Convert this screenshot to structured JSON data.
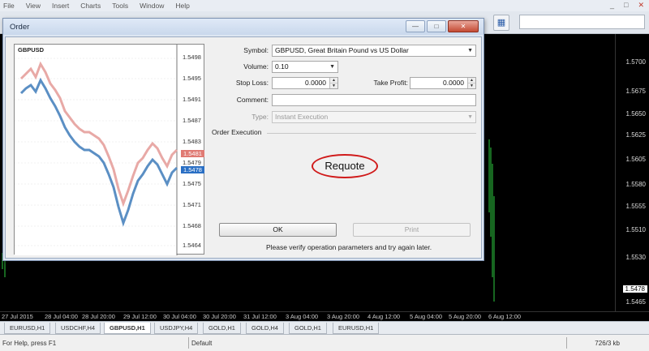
{
  "menu": [
    "File",
    "View",
    "Insert",
    "Charts",
    "Tools",
    "Window",
    "Help"
  ],
  "window_controls": [
    "_",
    "□",
    "✕"
  ],
  "chart": {
    "y_labels": [
      "1.5700",
      "1.5675",
      "1.5650",
      "1.5625",
      "1.5605",
      "1.5580",
      "1.5555",
      "1.5530",
      "1.5510",
      "1.5465"
    ],
    "price_tag": "1.5478",
    "x_labels": [
      "27 Jul 2015",
      "28 Jul 04:00",
      "28 Jul 20:00",
      "29 Jul 12:00",
      "30 Jul 04:00",
      "30 Jul 20:00",
      "31 Jul 12:00",
      "3 Aug 04:00",
      "3 Aug 20:00",
      "4 Aug 12:00",
      "5 Aug 04:00",
      "5 Aug 20:00",
      "6 Aug 12:00"
    ]
  },
  "tabs": [
    "EURUSD,H1",
    "USDCHF,H4",
    "GBPUSD,H1",
    "USDJPY,H4",
    "GOLD,H1",
    "GOLD,H4",
    "GOLD,H1",
    "EURUSD,H1"
  ],
  "active_tab": 2,
  "status": {
    "help": "For Help, press F1",
    "profile": "Default",
    "traffic": "726/3 kb"
  },
  "dialog": {
    "title": "Order",
    "buttons": [
      "—",
      "□",
      "✕"
    ],
    "mini_chart": {
      "symbol": "GBPUSD",
      "price_labels": [
        "1.5498",
        "1.5495",
        "1.5491",
        "1.5487",
        "1.5483",
        "1.5479",
        "1.5475",
        "1.5471",
        "1.5468",
        "1.5464"
      ],
      "ask_tag": "1.5481",
      "bid_tag": "1.5478"
    },
    "form": {
      "symbol_label": "Symbol:",
      "symbol_value": "GBPUSD, Great Britain Pound vs US Dollar",
      "volume_label": "Volume:",
      "volume_value": "0.10",
      "stop_loss_label": "Stop Loss:",
      "stop_loss_value": "0.0000",
      "take_profit_label": "Take Profit:",
      "take_profit_value": "0.0000",
      "comment_label": "Comment:",
      "comment_value": "",
      "type_label": "Type:",
      "type_value": "Instant Execution"
    },
    "section_title": "Order Execution",
    "requote": "Requote",
    "ok_button": "OK",
    "print_button": "Print",
    "note": "Please verify operation parameters and try again later."
  },
  "colors": {
    "ask_line": "#e8a9a6",
    "bid_line": "#5b8fc4",
    "requote_ring": "#d01a1a",
    "chart_candles": "#2ecc40"
  }
}
